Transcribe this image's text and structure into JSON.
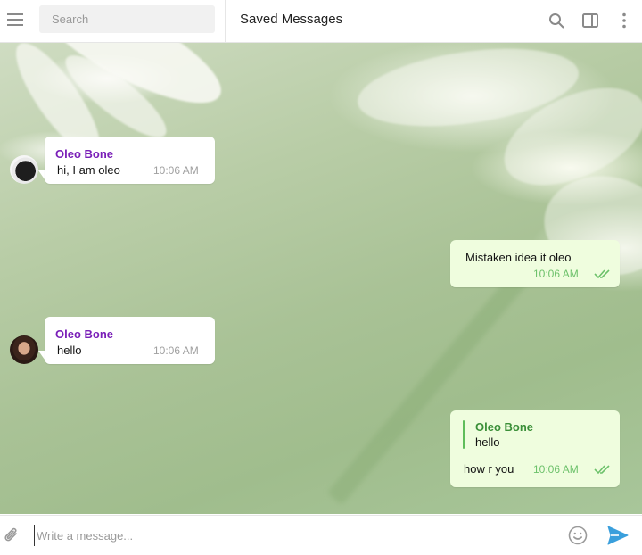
{
  "header": {
    "search_placeholder": "Search",
    "chat_title": "Saved Messages",
    "icons": [
      "menu-icon",
      "search-icon",
      "sidebar-toggle-icon",
      "more-vertical-icon"
    ]
  },
  "messages": [
    {
      "direction": "in",
      "sender": "Oleo Bone",
      "text": "hi, I am oleo",
      "time": "10:06 AM"
    },
    {
      "direction": "out",
      "text": "Mistaken idea it oleo",
      "time": "10:06 AM",
      "status": "read"
    },
    {
      "direction": "in",
      "sender": "Oleo Bone",
      "text": "hello",
      "time": "10:06 AM"
    },
    {
      "direction": "out",
      "reply_to": {
        "sender": "Oleo Bone",
        "text": "hello"
      },
      "text": "how r you",
      "time": "10:06 AM",
      "status": "read"
    }
  ],
  "composer": {
    "placeholder": "Write a message...",
    "icons": [
      "paperclip-icon",
      "emoji-icon",
      "send-icon"
    ]
  },
  "colors": {
    "incoming_bubble": "#ffffff",
    "outgoing_bubble": "#effdde",
    "sender_name": "#7a1fb8",
    "outgoing_time": "#6cc16a",
    "send_icon": "#3a9fdc"
  }
}
